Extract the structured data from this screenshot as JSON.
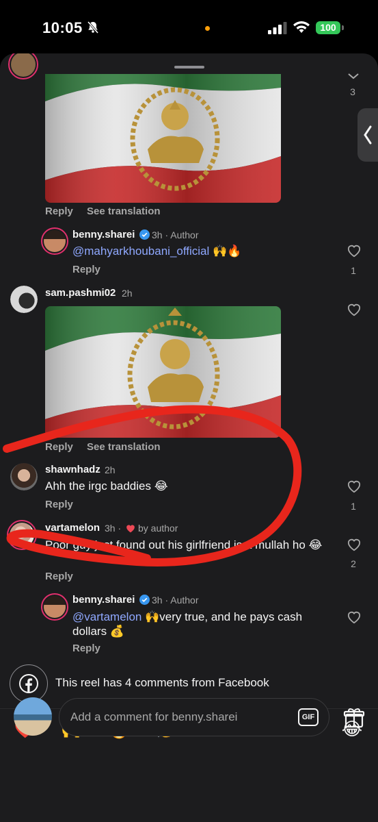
{
  "status_bar": {
    "time": "10:05",
    "battery": "100"
  },
  "post_author": "benny.sharei",
  "translation_label": "See translation",
  "reply_label": "Reply",
  "top_partial": {
    "like_count": "3"
  },
  "comments": [
    {
      "username": "benny.sharei",
      "meta": "3h · Author",
      "mention": "@mahyarkhoubani_official",
      "text_suffix": " 🙌🔥",
      "likes": "1"
    },
    {
      "username": "sam.pashmi02",
      "meta": "2h"
    },
    {
      "username": "shawnhadz",
      "meta": "2h",
      "text": "Ahh the irgc baddies 😂",
      "likes": "1"
    },
    {
      "username": "vartamelon",
      "meta_time": "3h ·",
      "meta_liked": "by author",
      "text": "Poor guy just found out his girlfriend is a mullah ho 😂",
      "likes": "2"
    },
    {
      "username": "benny.sharei",
      "meta": "3h · Author",
      "mention": "@vartamelon",
      "text_suffix": " 🙌very true, and he pays cash dollars 💰"
    }
  ],
  "facebook_notice": "This reel has 4 comments from Facebook",
  "emoji_bar": [
    "❤️",
    "🙌",
    "🔥",
    "👏",
    "😢",
    "😍",
    "😮",
    "😂"
  ],
  "composer": {
    "placeholder": "Add a comment for benny.sharei",
    "gif_label": "GIF"
  },
  "colors": {
    "sheet_bg": "#1c1c1e",
    "mention": "#8fa8ff",
    "muted": "#a8a8a8",
    "battery": "#34c759",
    "annotation": "#e8261c"
  },
  "icons": [
    "bell-slash-icon",
    "signal-icon",
    "wifi-icon",
    "chevron-left-icon",
    "heart-icon",
    "verified-icon",
    "facebook-icon",
    "gif-icon",
    "gift-icon"
  ]
}
